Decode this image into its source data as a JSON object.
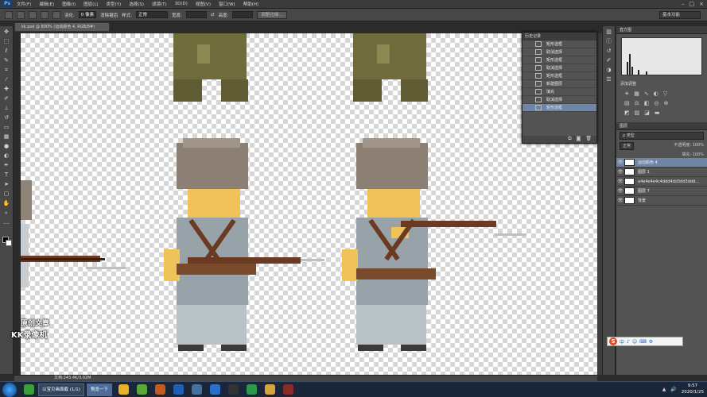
{
  "menubar": {
    "logo": "Ps",
    "items": [
      "文件(F)",
      "编辑(E)",
      "图像(I)",
      "图层(L)",
      "类型(Y)",
      "选择(S)",
      "滤镜(T)",
      "3D(D)",
      "视图(V)",
      "窗口(W)",
      "帮助(H)"
    ],
    "controls": [
      "–",
      "□",
      "×"
    ]
  },
  "optionsbar": {
    "feather_label": "羽化:",
    "feather_value": "0 像素",
    "antialias_label": "消除锯齿",
    "style_label": "样式:",
    "style_value": "正常",
    "width_label": "宽度:",
    "height_label": "高度:",
    "refine_button": "调整边缘...",
    "workspace": "基本功能"
  },
  "document": {
    "tab": "kk.psd @ 800% (运动颜色 4, RGB/8#)",
    "status": "文档:243.4K/3.02M"
  },
  "history": {
    "tab": "历史记录",
    "rows": [
      "矩形选框",
      "取消选择",
      "矩形选框",
      "取消选择",
      "矩形选框",
      "新建图层",
      "填充",
      "取消选择",
      "矩形选框"
    ],
    "selected_index": 8
  },
  "panels": {
    "histogram_tab": "直方图",
    "adjust_title": "添加调整",
    "layers_tab": "图层",
    "filter_label": "ρ 类型",
    "blend_mode": "正常",
    "opacity": "不透明度: 100%",
    "fill": "填充: 100%",
    "layers": [
      {
        "name": "运动颜色 4",
        "selected": true
      },
      {
        "name": "图层 1",
        "selected": false
      },
      {
        "name": "a4e4e4e4c4ddd4dd3dd3ddd...",
        "selected": false
      },
      {
        "name": "图层 7",
        "selected": false
      },
      {
        "name": "背景",
        "selected": false
      }
    ]
  },
  "ime": {
    "logo": "S",
    "items": [
      "中",
      "♪",
      "☺",
      "⌨",
      "⚙"
    ]
  },
  "watermark": {
    "line1": "原创文章",
    "line2": "KK录像机"
  },
  "taskbar": {
    "buttons": [
      {
        "label": "以宝贝画面截 (1/1)",
        "active": false
      },
      {
        "label": "预览一下",
        "active": true
      }
    ],
    "clock_time": "9:57",
    "clock_date": "2020/1/25"
  },
  "colors": {
    "selection": "#6d86a8",
    "panel": "#535353",
    "canvas_check": "#d6d6d6"
  }
}
